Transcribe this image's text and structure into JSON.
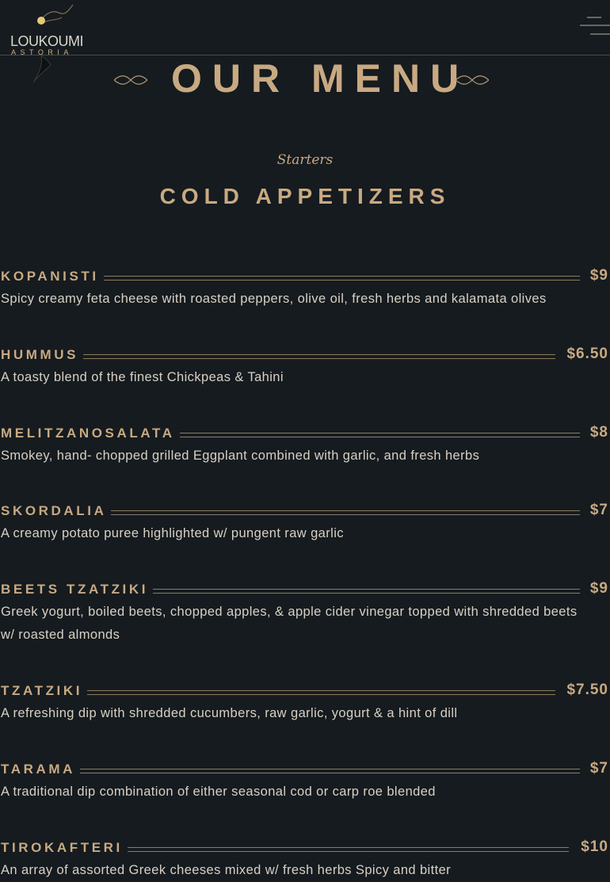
{
  "brand": {
    "name": "LOUKOUMI",
    "sub": "ASTORIA"
  },
  "page": {
    "title": "OUR MENU",
    "subtitle": "Starters",
    "section": "COLD APPETIZERS"
  },
  "items": [
    {
      "name": "KOPANISTI",
      "price": "$9",
      "desc": "Spicy creamy feta cheese with roasted peppers, olive oil, fresh herbs and kalamata olives"
    },
    {
      "name": "HUMMUS",
      "price": "$6.50",
      "desc": "A toasty blend of the finest Chickpeas & Tahini"
    },
    {
      "name": "MELITZANOSALATA",
      "price": "$8",
      "desc": "Smokey, hand- chopped grilled Eggplant combined with garlic, and fresh herbs"
    },
    {
      "name": "SKORDALIA",
      "price": "$7",
      "desc": "A creamy potato puree highlighted w/ pungent raw garlic"
    },
    {
      "name": "BEETS TZATZIKI",
      "price": "$9",
      "desc": "Greek yogurt, boiled beets, chopped apples, & apple cider vinegar topped with shredded beets w/ roasted almonds"
    },
    {
      "name": "TZATZIKI",
      "price": "$7.50",
      "desc": "A refreshing dip with shredded cucumbers, raw garlic, yogurt & a hint of dill"
    },
    {
      "name": "TARAMA",
      "price": "$7",
      "desc": "A traditional dip combination of either seasonal cod or carp roe blended"
    },
    {
      "name": "TIROKAFTERI",
      "price": "$10",
      "desc": "An array of assorted Greek cheeses mixed w/ fresh herbs Spicy and bitter"
    }
  ],
  "icons": {
    "menu": "hamburger-menu-icon",
    "ornament": "ornament-icon"
  },
  "colors": {
    "background": "#151b1f",
    "accent": "#c9a982",
    "text": "#d8d0c4"
  }
}
